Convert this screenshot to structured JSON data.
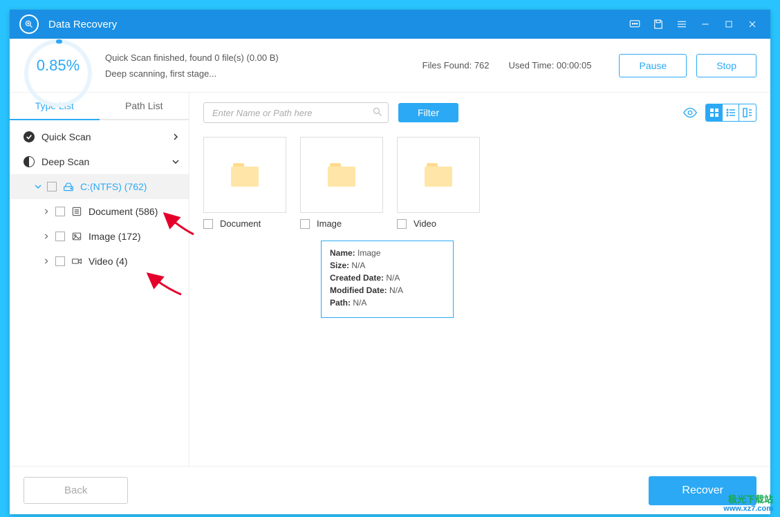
{
  "titlebar": {
    "title": "Data Recovery"
  },
  "info": {
    "percent": "0.85%",
    "line1": "Quick Scan finished, found 0 file(s) (0.00  B)",
    "line2": "Deep scanning, first stage...",
    "files_found_label": "Files Found: ",
    "files_found_value": "762",
    "used_time_label": "Used Time: ",
    "used_time_value": "00:00:05",
    "pause": "Pause",
    "stop": "Stop"
  },
  "tabs": {
    "type": "Type List",
    "path": "Path List"
  },
  "tree": {
    "quick": "Quick Scan",
    "deep": "Deep Scan",
    "drive": "C:(NTFS) (762)",
    "doc": "Document (586)",
    "img": "Image (172)",
    "vid": "Video (4)"
  },
  "toolbar": {
    "search_ph": "Enter Name or Path here",
    "filter": "Filter"
  },
  "cards": {
    "doc": "Document",
    "img": "Image",
    "vid": "Video"
  },
  "tooltip": {
    "name_l": "Name: ",
    "name": "Image",
    "size_l": "Size: ",
    "size": "N/A",
    "cdate_l": "Created Date: ",
    "cdate": "N/A",
    "mdate_l": "Modified Date: ",
    "mdate": "N/A",
    "path_l": "Path: ",
    "path": "N/A"
  },
  "footer": {
    "back": "Back",
    "recover": "Recover"
  },
  "watermark": {
    "line1": "极光下载站",
    "line2": "www.xz7.com"
  }
}
